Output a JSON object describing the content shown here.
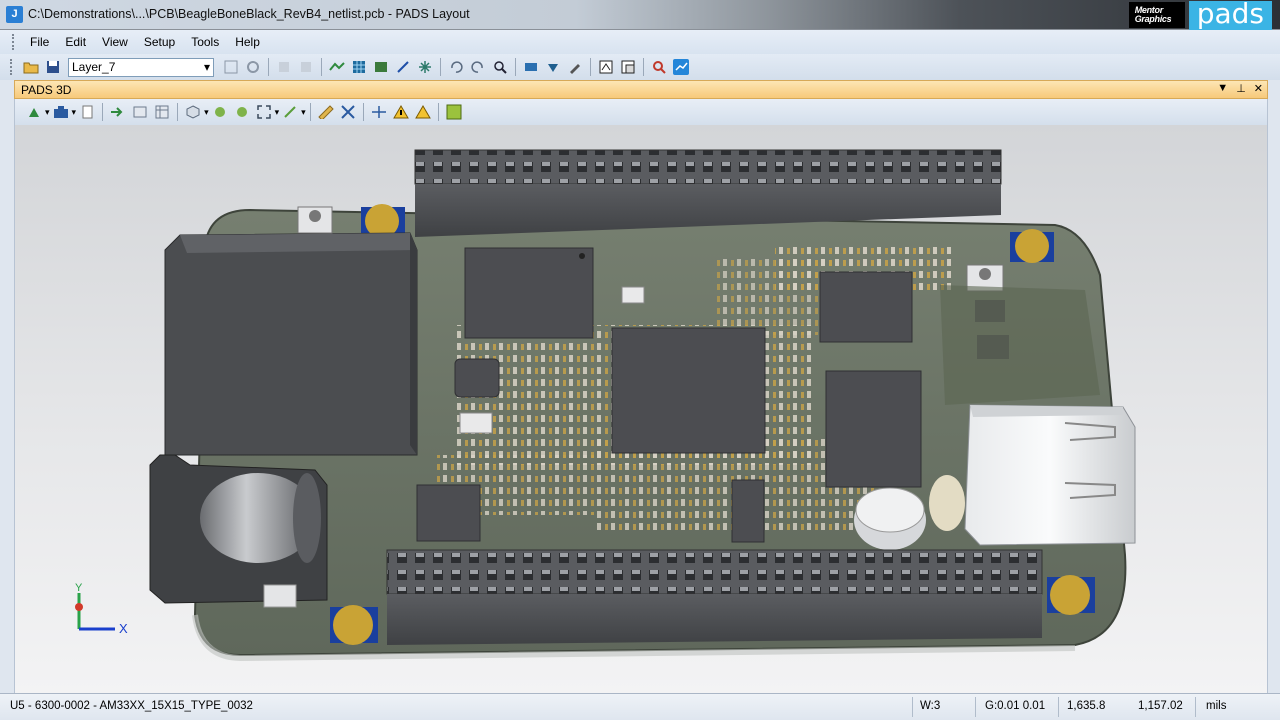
{
  "window": {
    "title": "C:\\Demonstrations\\...\\PCB\\BeagleBoneBlack_RevB4_netlist.pcb - PADS Layout",
    "app_icon_letter": "J",
    "brand_mentor": "Mentor Graphics",
    "brand_pads": "pads"
  },
  "menu": [
    "File",
    "Edit",
    "View",
    "Setup",
    "Tools",
    "Help"
  ],
  "toolbar": {
    "layer_value": "Layer_7",
    "icons": [
      "open-folder-icon",
      "save-icon",
      "properties-icon",
      "refresh-icon",
      "undo-disabled-icon",
      "redo-disabled-icon",
      "route-icon",
      "grid-icon",
      "image-icon",
      "line-icon",
      "net-icon",
      "undo-icon",
      "redo-icon",
      "zoom-icon",
      "view-icon",
      "pin-icon",
      "highlight-icon",
      "pcb-icon",
      "window-icon",
      "verify-icon",
      "3d-icon"
    ]
  },
  "panel": {
    "title": "PADS 3D"
  },
  "toolbar3d": {
    "icons": [
      "import-icon",
      "camera-icon",
      "new-doc-icon",
      "export-icon",
      "layers-icon",
      "board-icon",
      "view-cube-icon",
      "rotate-left-icon",
      "rotate-right-icon",
      "fit-icon",
      "filter-icon",
      "measure-icon",
      "section-icon",
      "pin-center-icon",
      "warning-icon",
      "warning-yellow-icon",
      "checklist-icon"
    ]
  },
  "axis": {
    "y": "Y",
    "x": "X"
  },
  "status": {
    "component": "U5 - 6300-0002 - AM33XX_15X15_TYPE_0032",
    "width": "W:3",
    "grid": "G:0.01 0.01",
    "x": "1,635.8",
    "y": "1,157.02",
    "units": "mils"
  },
  "colors": {
    "pcb": "#6b7566",
    "panel_header": "#f7c97a",
    "pad_gold": "#c9a335",
    "accent_blue": "#1a3f9e"
  }
}
